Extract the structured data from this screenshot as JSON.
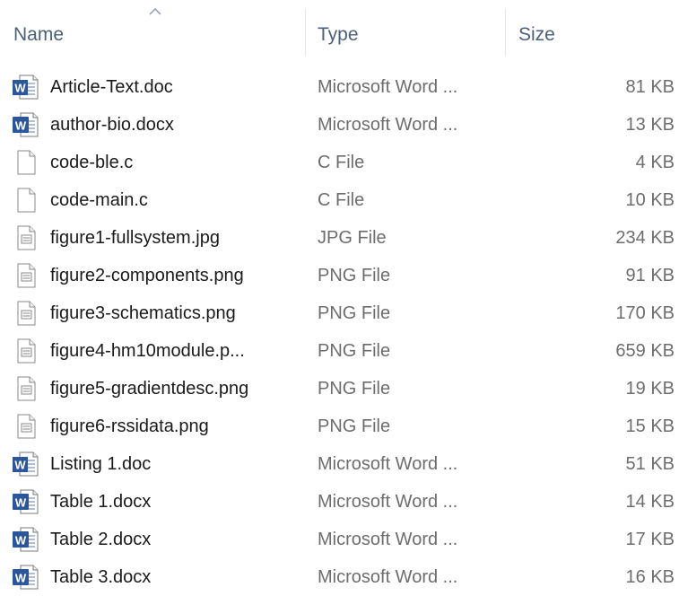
{
  "columns": {
    "name": "Name",
    "type": "Type",
    "size": "Size"
  },
  "files": [
    {
      "name": "Article-Text.doc",
      "type": "Microsoft Word ...",
      "size": "81 KB",
      "icon": "word-doc-icon"
    },
    {
      "name": "author-bio.docx",
      "type": "Microsoft Word ...",
      "size": "13 KB",
      "icon": "word-docx-icon"
    },
    {
      "name": "code-ble.c",
      "type": "C File",
      "size": "4 KB",
      "icon": "blank-file-icon"
    },
    {
      "name": "code-main.c",
      "type": "C File",
      "size": "10 KB",
      "icon": "blank-file-icon"
    },
    {
      "name": "figure1-fullsystem.jpg",
      "type": "JPG File",
      "size": "234 KB",
      "icon": "image-file-icon"
    },
    {
      "name": "figure2-components.png",
      "type": "PNG File",
      "size": "91 KB",
      "icon": "image-file-icon"
    },
    {
      "name": "figure3-schematics.png",
      "type": "PNG File",
      "size": "170 KB",
      "icon": "image-file-icon"
    },
    {
      "name": "figure4-hm10module.p...",
      "type": "PNG File",
      "size": "659 KB",
      "icon": "image-file-icon"
    },
    {
      "name": "figure5-gradientdesc.png",
      "type": "PNG File",
      "size": "19 KB",
      "icon": "image-file-icon"
    },
    {
      "name": "figure6-rssidata.png",
      "type": "PNG File",
      "size": "15 KB",
      "icon": "image-file-icon"
    },
    {
      "name": "Listing 1.doc",
      "type": "Microsoft Word ...",
      "size": "51 KB",
      "icon": "word-doc-icon"
    },
    {
      "name": "Table 1.docx",
      "type": "Microsoft Word ...",
      "size": "14 KB",
      "icon": "word-docx-icon"
    },
    {
      "name": "Table 2.docx",
      "type": "Microsoft Word ...",
      "size": "17 KB",
      "icon": "word-docx-icon"
    },
    {
      "name": "Table 3.docx",
      "type": "Microsoft Word ...",
      "size": "16 KB",
      "icon": "word-docx-icon"
    }
  ],
  "colors": {
    "header_text": "#4c607a",
    "word_blue": "#2b579a",
    "secondary_text": "#6d6d6d"
  }
}
